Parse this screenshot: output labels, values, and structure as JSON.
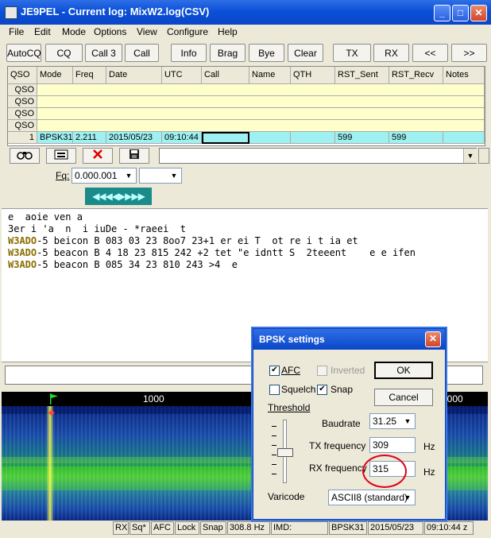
{
  "window": {
    "title": "JE9PEL - Current log: MixW2.log(CSV)",
    "controls": [
      "_",
      "□",
      "✕"
    ]
  },
  "menu": [
    "File",
    "Edit",
    "Mode",
    "Options",
    "View",
    "Configure",
    "Help"
  ],
  "toolbar": [
    "AutoCQ",
    "CQ",
    "Call 3",
    "Call",
    "Info",
    "Brag",
    "Bye",
    "Clear",
    "TX",
    "RX",
    "<<",
    ">>"
  ],
  "log": {
    "columns": [
      "QSO",
      "Mode",
      "Freq",
      "Date",
      "UTC",
      "Call",
      "Name",
      "QTH",
      "RST_Sent",
      "RST_Recv",
      "Notes"
    ],
    "empty_rows": [
      "QSO",
      "QSO",
      "QSO",
      "QSO"
    ],
    "current": {
      "qso": "1",
      "mode": "BPSK31",
      "freq": "2.211",
      "date": "2015/05/23",
      "utc": "09:10:44",
      "call": "",
      "name": "",
      "qth": "",
      "rst_sent": "599",
      "rst_recv": "599",
      "notes": ""
    }
  },
  "freq_control": {
    "label": "Fq:",
    "value": "0.000.001",
    "mode_button": "◀◀◀◀▶▶▶▶"
  },
  "rx_text": [
    {
      "call": "",
      "text": "e  aoie ven a"
    },
    {
      "call": "",
      "text": "3er i 'a  n  i iuDe - *raeei  t"
    },
    {
      "call": "W3ADO",
      "text": "-5 beicon B 083 03 23 8oo7 23+1 er ei T  ot re i t ia et"
    },
    {
      "call": "W3ADO",
      "text": "-5 beacon B 4 18 23 815 242 +2 tet \"e idntt S  2teeent    e e ifen"
    },
    {
      "call": "W3ADO",
      "text": "-5 beacon B 085 34 23 810 243 >4  e"
    }
  ],
  "waterfall": {
    "scale_labels": [
      "1000",
      "2000"
    ]
  },
  "status": [
    "RX",
    "Sq*",
    "AFC",
    "Lock",
    "Snap",
    "308.8 Hz",
    "IMD:",
    "BPSK31",
    "2015/05/23",
    "09:10:44 z"
  ],
  "dialog": {
    "title": "BPSK settings",
    "afc_label": "AFC",
    "inverted_label": "Inverted",
    "squelch_label": "Squelch",
    "snap_label": "Snap",
    "threshold_label": "Threshold",
    "ok_label": "OK",
    "cancel_label": "Cancel",
    "baudrate_label": "Baudrate",
    "baudrate_value": "31.25",
    "tx_label": "TX frequency",
    "tx_value": "309",
    "tx_unit": "Hz",
    "rx_label": "RX frequency",
    "rx_value": "315",
    "rx_unit": "Hz",
    "varicode_label": "Varicode",
    "varicode_value": "ASCII8 (standard)"
  },
  "colors": {
    "title_blue": "#0b50d8",
    "log_yellow": "#ffffcc",
    "log_cyan": "#9ff0f0",
    "callsign": "#8a6d00",
    "highlight_circle": "#e0001a"
  }
}
